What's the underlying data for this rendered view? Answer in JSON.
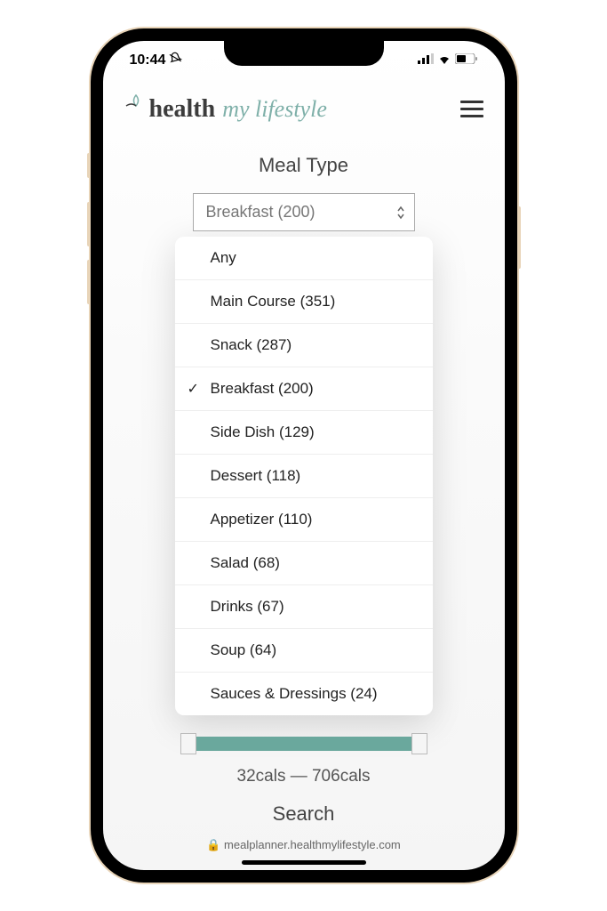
{
  "status": {
    "time": "10:44",
    "bell": "🔕"
  },
  "logo": {
    "text1": "health",
    "text2": "my lifestyle"
  },
  "meal_type": {
    "title": "Meal Type",
    "selected": "Breakfast (200)",
    "options": [
      {
        "label": "Any",
        "selected": false
      },
      {
        "label": "Main Course (351)",
        "selected": false
      },
      {
        "label": "Snack (287)",
        "selected": false
      },
      {
        "label": "Breakfast (200)",
        "selected": true
      },
      {
        "label": "Side Dish (129)",
        "selected": false
      },
      {
        "label": "Dessert (118)",
        "selected": false
      },
      {
        "label": "Appetizer (110)",
        "selected": false
      },
      {
        "label": "Salad (68)",
        "selected": false
      },
      {
        "label": "Drinks (67)",
        "selected": false
      },
      {
        "label": "Soup (64)",
        "selected": false
      },
      {
        "label": "Sauces & Dressings (24)",
        "selected": false
      }
    ]
  },
  "calories": {
    "range_text": "32cals — 706cals"
  },
  "search": {
    "title": "Search"
  },
  "url": "mealplanner.healthmylifestyle.com"
}
